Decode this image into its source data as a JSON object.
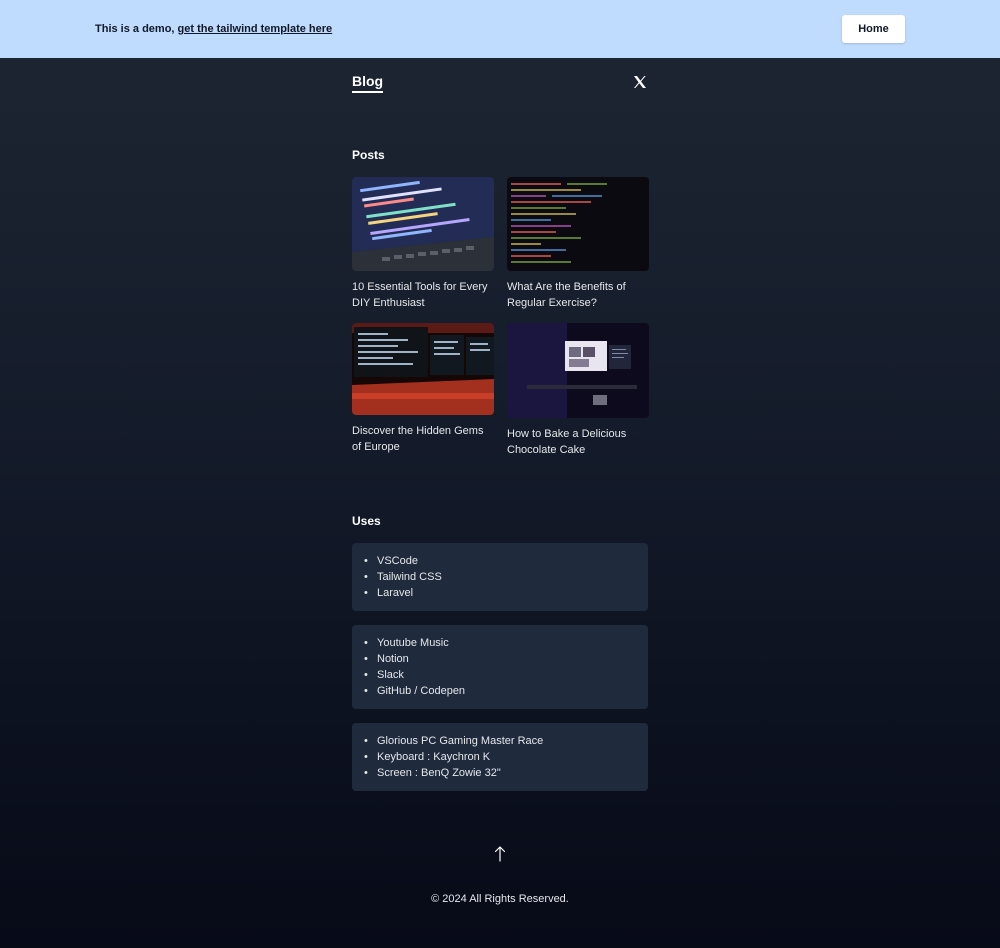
{
  "banner": {
    "text": "This is a demo, ",
    "link_text": "get the tailwind template here",
    "home_label": "Home"
  },
  "nav": {
    "blog_label": "Blog",
    "social_icon": "x-icon"
  },
  "posts": {
    "title": "Posts",
    "items": [
      {
        "title": "10 Essential Tools for Every DIY Enthusiast",
        "image": "code-on-laptop-image"
      },
      {
        "title": "What Are the Benefits of Regular Exercise?",
        "image": "code-screen-dark-image"
      },
      {
        "title": "Discover the Hidden Gems of Europe",
        "image": "multi-monitor-setup-image"
      },
      {
        "title": "How to Bake a Delicious Chocolate Cake",
        "image": "dark-room-monitor-image"
      }
    ]
  },
  "uses": {
    "title": "Uses",
    "groups": [
      [
        "VSCode",
        "Tailwind CSS",
        "Laravel"
      ],
      [
        "Youtube Music",
        "Notion",
        "Slack",
        "GitHub / Codepen"
      ],
      [
        "Glorious PC Gaming Master Race",
        "Keyboard : Kaychron K",
        "Screen : BenQ Zowie 32\""
      ]
    ]
  },
  "footer": {
    "copyright": "© 2024 All Rights Reserved.",
    "scroll_top_icon": "arrow-up-icon"
  },
  "colors": {
    "banner_bg": "#bfdbfe",
    "card_bg": "#1f2a3d",
    "page_top": "#1e2633",
    "page_bottom": "#070a17"
  }
}
